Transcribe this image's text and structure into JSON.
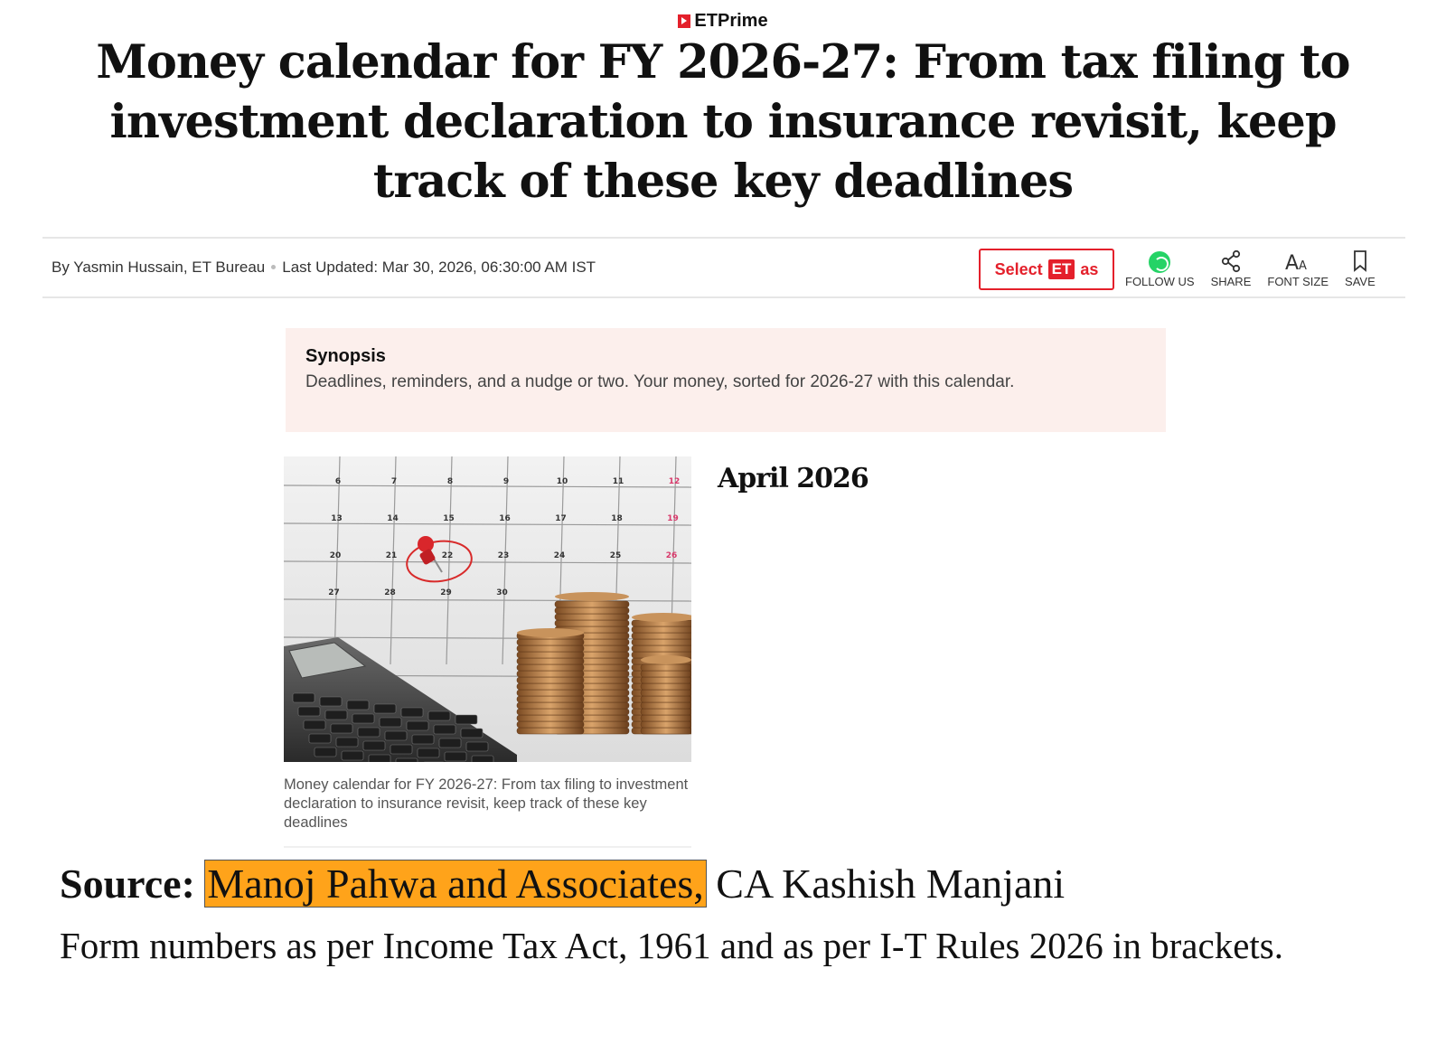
{
  "brand": {
    "name": "ETPrime"
  },
  "article": {
    "title": "Money calendar for FY 2026-27: From tax filing to investment declaration to insurance revisit, keep track of these key deadlines",
    "byline": "By Yasmin Hussain, ET Bureau",
    "updated": "Last Updated: Mar 30, 2026, 06:30:00 AM IST"
  },
  "select_button": {
    "select": "Select",
    "badge": "ET",
    "suffix": "as"
  },
  "actions": [
    {
      "label": "FOLLOW US",
      "icon": "whatsapp-icon"
    },
    {
      "label": "SHARE",
      "icon": "share-icon"
    },
    {
      "label": "FONT SIZE",
      "icon": "font-size-icon"
    },
    {
      "label": "SAVE",
      "icon": "bookmark-icon"
    }
  ],
  "synopsis": {
    "heading": "Synopsis",
    "text": "Deadlines, reminders, and a nudge or two. Your money, sorted for 2026-27 with this calendar."
  },
  "image": {
    "caption": "Money calendar for FY 2026-27: From tax filing to investment declaration to insurance revisit, keep track of these key deadlines",
    "calendar_days": [
      [
        "6",
        "7",
        "8",
        "9",
        "10",
        "11",
        "12"
      ],
      [
        "13",
        "14",
        "15",
        "16",
        "17",
        "18",
        "19"
      ],
      [
        "20",
        "21",
        "22",
        "23",
        "24",
        "25",
        "26"
      ],
      [
        "27",
        "28",
        "29",
        "30",
        "",
        "",
        ""
      ]
    ]
  },
  "section": {
    "month": "April 2026"
  },
  "source": {
    "label": "Source:",
    "highlighted": "Manoj Pahwa and Associates,",
    "rest": " CA Kashish Manjani"
  },
  "note": "Form numbers  as per Income Tax Act, 1961 and as per I-T Rules 2026 in brackets.",
  "colors": {
    "accent": "#e4202b",
    "synopsis_bg": "#fcefec",
    "highlight": "#ffa31a",
    "whatsapp": "#25d366"
  }
}
